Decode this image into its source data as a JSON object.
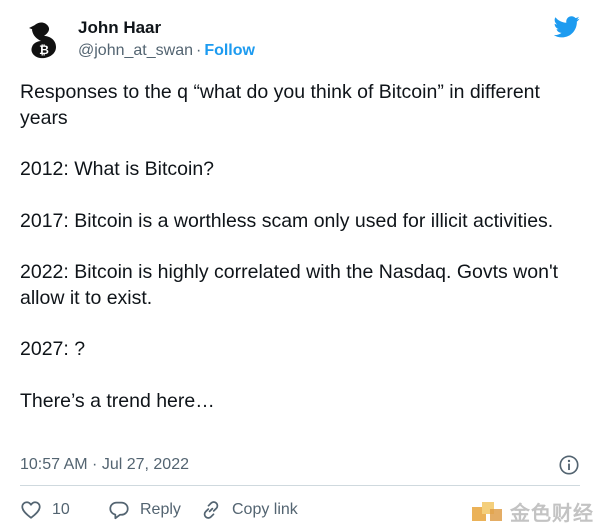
{
  "author": {
    "name": "John Haar",
    "handle": "@john_at_swan",
    "separator": "·",
    "follow_label": "Follow"
  },
  "tweet": {
    "paragraphs": [
      "Responses to the q “what do you think of Bitcoin” in different years",
      "2012: What is Bitcoin?",
      "2017: Bitcoin is a worthless scam only used for illicit activities.",
      "2022: Bitcoin is highly correlated with the Nasdaq. Govts won't allow it to exist.",
      "2027: ?",
      "There’s a trend here…"
    ],
    "timestamp": "10:57 AM · Jul 27, 2022"
  },
  "actions": {
    "like_count": "10",
    "reply_label": "Reply",
    "copy_label": "Copy link"
  },
  "watermark": {
    "text": "金色财经"
  },
  "icons": {
    "avatar": "swan-bitcoin-avatar",
    "brand": "twitter-bird-icon",
    "info": "info-icon",
    "like": "heart-icon",
    "reply": "reply-bubble-icon",
    "copy": "link-icon"
  },
  "colors": {
    "accent": "#1d9bf0",
    "text": "#0f1419",
    "muted": "#536471"
  }
}
